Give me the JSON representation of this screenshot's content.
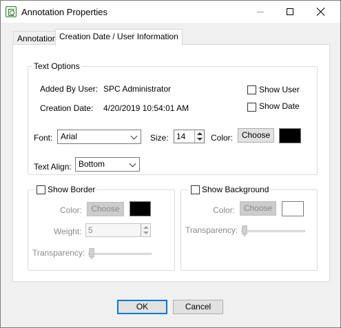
{
  "window": {
    "title": "Annotation Properties"
  },
  "tabs": {
    "annotation": "Annotation",
    "creation": "Creation Date / User Information"
  },
  "text_options": {
    "group_label": "Text Options",
    "added_by_label": "Added By User:",
    "added_by_value": "SPC Administrator",
    "creation_date_label": "Creation Date:",
    "creation_date_value": "4/20/2019 10:54:01 AM",
    "show_user_label": "Show User",
    "show_user_checked": false,
    "show_date_label": "Show Date",
    "show_date_checked": false,
    "font_label": "Font:",
    "font_value": "Arial",
    "size_label": "Size:",
    "size_value": "14",
    "color_label": "Color:",
    "choose_label": "Choose",
    "color_value": "#000000",
    "text_align_label": "Text Align:",
    "text_align_value": "Bottom"
  },
  "border": {
    "checkbox_label": "Show Border",
    "checked": false,
    "color_label": "Color:",
    "choose_label": "Choose",
    "color_value": "#000000",
    "weight_label": "Weight:",
    "weight_value": "5",
    "transparency_label": "Transparency:",
    "transparency_value": 0
  },
  "background": {
    "checkbox_label": "Show Background",
    "checked": false,
    "color_label": "Color:",
    "choose_label": "Choose",
    "color_value": "#ffffff",
    "transparency_label": "Transparency:",
    "transparency_value": 0
  },
  "footer": {
    "ok_label": "OK",
    "cancel_label": "Cancel"
  },
  "colors": {
    "accent": "#0078d7",
    "disabled_text": "#8a8a8a",
    "icon_green": "#2f7d32"
  }
}
